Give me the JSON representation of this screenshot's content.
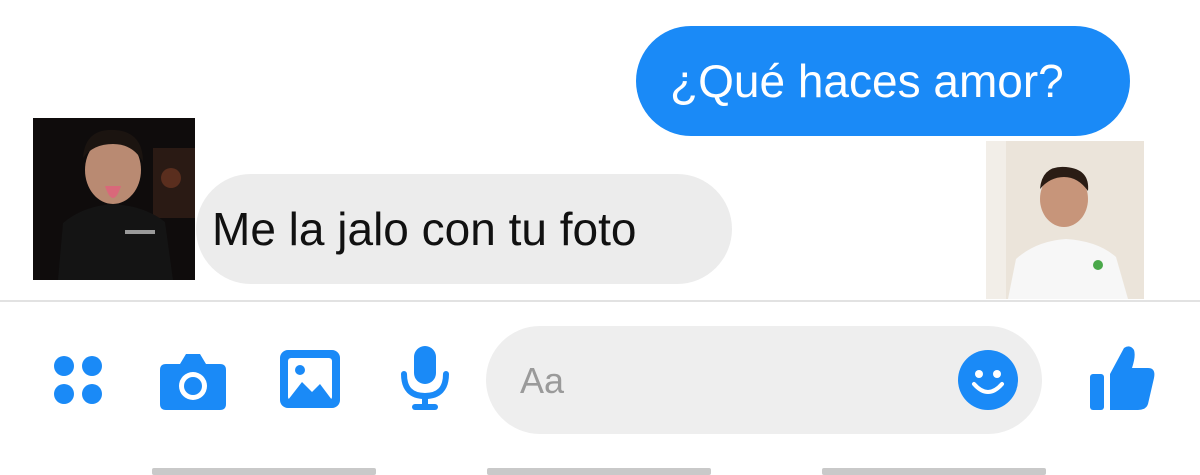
{
  "messages": [
    {
      "direction": "outgoing",
      "text": "¿Qué haces amor?"
    },
    {
      "direction": "incoming",
      "text": "Me la jalo con tu foto"
    }
  ],
  "composer": {
    "placeholder": "Aa"
  },
  "toolbar": {
    "icons": [
      "apps-icon",
      "camera-icon",
      "gallery-icon",
      "microphone-icon",
      "emoji-icon",
      "thumbs-up-icon"
    ]
  },
  "colors": {
    "accent": "#1a8af7",
    "incoming_bubble": "#ececec",
    "composer_bg": "#eeeeee"
  }
}
